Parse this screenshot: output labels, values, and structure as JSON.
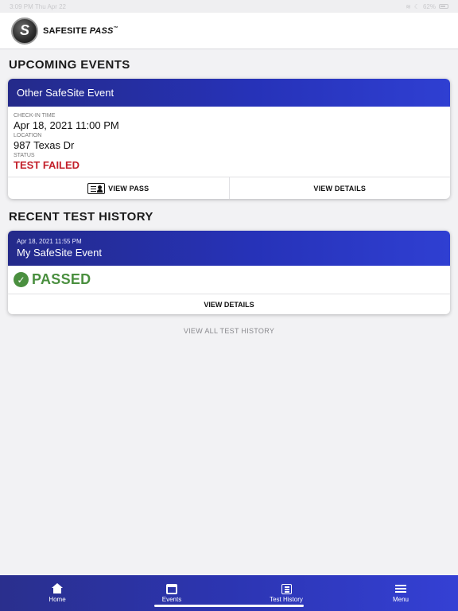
{
  "status_bar": {
    "time_date": "3:09 PM  Thu Apr 22",
    "battery": "62%"
  },
  "header": {
    "logo_letter": "S",
    "brand_main": "SAFESITE",
    "brand_pass": "PASS",
    "brand_tm": "™"
  },
  "upcoming": {
    "section_title": "UPCOMING EVENTS",
    "card": {
      "event_name": "Other SafeSite Event",
      "checkin_label": "CHECK-IN TIME",
      "checkin_value": "Apr 18, 2021 11:00 PM",
      "location_label": "LOCATION",
      "location_value": "987 Texas Dr",
      "status_label": "STATUS",
      "status_value": "TEST FAILED",
      "view_pass_label": "VIEW PASS",
      "view_details_label": "VIEW DETAILS"
    }
  },
  "history": {
    "section_title": "RECENT TEST HISTORY",
    "card": {
      "date": "Apr 18, 2021 11:55 PM",
      "event_name": "My SafeSite Event",
      "result": "PASSED",
      "view_details_label": "VIEW DETAILS"
    },
    "view_all_label": "VIEW ALL TEST HISTORY"
  },
  "bottom_nav": {
    "items": [
      {
        "label": "Home",
        "icon": "home-icon"
      },
      {
        "label": "Events",
        "icon": "calendar-icon"
      },
      {
        "label": "Test History",
        "icon": "list-icon"
      },
      {
        "label": "Menu",
        "icon": "menu-icon"
      }
    ]
  },
  "colors": {
    "accent_blue": "#2632b8",
    "failed_red": "#c21f2a",
    "passed_green": "#4a8f3f"
  }
}
